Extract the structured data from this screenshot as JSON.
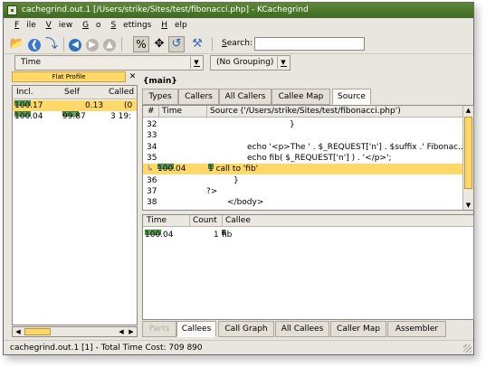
{
  "window": {
    "title": "cachegrind.out.1 [/Users/strike/Sites/test/fibonacci.php] - KCachegrind"
  },
  "menu": [
    "File",
    "View",
    "Go",
    "Settings",
    "Help"
  ],
  "toolbar": {
    "search_label": "Search:",
    "search_value": "",
    "icons": [
      "open-icon",
      "back-icon",
      "forward-icon",
      "up-icon",
      "percentage-icon",
      "move-icon",
      "cycle-icon",
      "expand-icon"
    ]
  },
  "selectors": {
    "event_type": "Time",
    "grouping": "(No Grouping)"
  },
  "flat_profile": {
    "title": "Flat Profile",
    "columns": [
      "Incl.",
      "Self",
      "Called"
    ],
    "rows": [
      {
        "incl": "100.17",
        "self": "0.13",
        "called": "(0",
        "bar_incl": 1.0,
        "bar_self": 0.0
      },
      {
        "incl": "100.04",
        "self": "99.87",
        "called": "3 19:",
        "bar_incl": 1.0,
        "bar_self": 1.0
      }
    ]
  },
  "main": {
    "title": "{main}",
    "top_tabs": [
      "Types",
      "Callers",
      "All Callers",
      "Callee Map",
      "Source"
    ],
    "top_active": 4,
    "source": {
      "columns": [
        "#",
        "Time",
        "Source ('/Users/strike/Sites/test/fibonacci.php')"
      ],
      "lines": [
        {
          "num": "32",
          "time": "",
          "code": "}",
          "call": false
        },
        {
          "num": "33",
          "time": "",
          "code": "",
          "call": false
        },
        {
          "num": "34",
          "time": "",
          "code": "echo '<p>The ' . $_REQUEST['n'] . $suffix .' Fibonac...",
          "call": false
        },
        {
          "num": "35",
          "time": "",
          "code": "echo fib( $_REQUEST['n'] ) . '</p>';",
          "call": false
        },
        {
          "num": "",
          "time": "100.04",
          "code": "1 call to 'fib'",
          "call": true
        },
        {
          "num": "36",
          "time": "",
          "code": "}",
          "call": false
        },
        {
          "num": "37",
          "time": "",
          "code": "?>",
          "call": false
        },
        {
          "num": "38",
          "time": "",
          "code": "</body>",
          "call": false
        }
      ]
    },
    "callees": {
      "columns": [
        "Time",
        "Count",
        "Callee"
      ],
      "rows": [
        {
          "time": "100.04",
          "count": "1",
          "callee": "fib"
        }
      ]
    },
    "bottom_tabs": [
      "Parts",
      "Callees",
      "Call Graph",
      "All Callees",
      "Caller Map",
      "Assembler"
    ],
    "bottom_active": 1
  },
  "status": {
    "text": "cachegrind.out.1 [1] - Total Time Cost:  709 890"
  },
  "colors": {
    "highlight": "#ffd867",
    "bar": "#63a25a",
    "titlebar": "#4f7a2d"
  }
}
